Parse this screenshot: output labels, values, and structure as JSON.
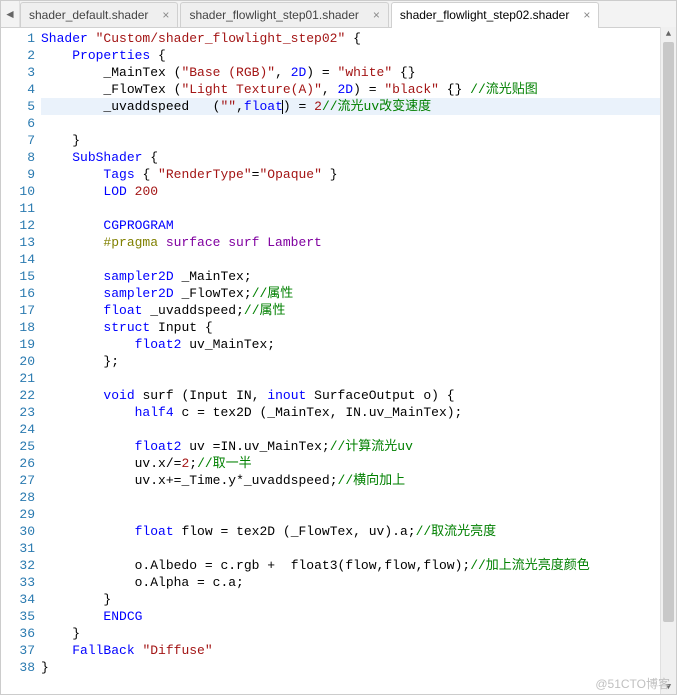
{
  "tabs": [
    {
      "label": "shader_default.shader",
      "active": false
    },
    {
      "label": "shader_flowlight_step01.shader",
      "active": false
    },
    {
      "label": "shader_flowlight_step02.shader",
      "active": true
    }
  ],
  "nav_prev": "◄",
  "nav_next": "",
  "close_glyph": "×",
  "scroll_up": "▲",
  "scroll_down": "▼",
  "watermark": "@51CTO博客",
  "current_line": 5,
  "code": [
    {
      "n": 1,
      "tokens": [
        [
          "kw",
          "Shader"
        ],
        [
          "op",
          " "
        ],
        [
          "str",
          "\"Custom/shader_flowlight_step02\""
        ],
        [
          "op",
          " {"
        ]
      ]
    },
    {
      "n": 2,
      "tokens": [
        [
          "op",
          "    "
        ],
        [
          "kw",
          "Properties"
        ],
        [
          "op",
          " {"
        ]
      ]
    },
    {
      "n": 3,
      "tokens": [
        [
          "op",
          "        "
        ],
        [
          "ident",
          "_MainTex"
        ],
        [
          "op",
          " ("
        ],
        [
          "str",
          "\"Base (RGB)\""
        ],
        [
          "op",
          ", "
        ],
        [
          "kw",
          "2D"
        ],
        [
          "op",
          ") = "
        ],
        [
          "str",
          "\"white\""
        ],
        [
          "op",
          " {}"
        ]
      ]
    },
    {
      "n": 4,
      "tokens": [
        [
          "op",
          "        "
        ],
        [
          "ident",
          "_FlowTex"
        ],
        [
          "op",
          " ("
        ],
        [
          "str",
          "\"Light Texture(A)\""
        ],
        [
          "op",
          ", "
        ],
        [
          "kw",
          "2D"
        ],
        [
          "op",
          ") = "
        ],
        [
          "str",
          "\"black\""
        ],
        [
          "op",
          " {} "
        ],
        [
          "comment",
          "//流光贴图"
        ]
      ]
    },
    {
      "n": 5,
      "tokens": [
        [
          "op",
          "        "
        ],
        [
          "ident",
          "_uvaddspeed"
        ],
        [
          "op",
          "   ("
        ],
        [
          "str",
          "\"\""
        ],
        [
          "op",
          ","
        ],
        [
          "kw",
          "float"
        ],
        [
          "caret",
          ""
        ],
        [
          "op",
          ") = "
        ],
        [
          "num",
          "2"
        ],
        [
          "comment",
          "//流光uv改变速度"
        ]
      ]
    },
    {
      "n": 6,
      "tokens": [
        [
          "op",
          ""
        ]
      ]
    },
    {
      "n": 7,
      "tokens": [
        [
          "op",
          "    }"
        ]
      ]
    },
    {
      "n": 8,
      "tokens": [
        [
          "op",
          "    "
        ],
        [
          "kw",
          "SubShader"
        ],
        [
          "op",
          " {"
        ]
      ]
    },
    {
      "n": 9,
      "tokens": [
        [
          "op",
          "        "
        ],
        [
          "kw",
          "Tags"
        ],
        [
          "op",
          " { "
        ],
        [
          "str",
          "\"RenderType\""
        ],
        [
          "op",
          "="
        ],
        [
          "str",
          "\"Opaque\""
        ],
        [
          "op",
          " }"
        ]
      ]
    },
    {
      "n": 10,
      "tokens": [
        [
          "op",
          "        "
        ],
        [
          "kw",
          "LOD"
        ],
        [
          "op",
          " "
        ],
        [
          "num",
          "200"
        ]
      ]
    },
    {
      "n": 11,
      "tokens": [
        [
          "op",
          ""
        ]
      ]
    },
    {
      "n": 12,
      "tokens": [
        [
          "op",
          "        "
        ],
        [
          "kw",
          "CGPROGRAM"
        ]
      ]
    },
    {
      "n": 13,
      "tokens": [
        [
          "op",
          "        "
        ],
        [
          "pragma",
          "#pragma"
        ],
        [
          "type",
          " surface surf Lambert"
        ]
      ]
    },
    {
      "n": 14,
      "tokens": [
        [
          "op",
          ""
        ]
      ]
    },
    {
      "n": 15,
      "tokens": [
        [
          "op",
          "        "
        ],
        [
          "kw",
          "sampler2D"
        ],
        [
          "op",
          " "
        ],
        [
          "ident",
          "_MainTex"
        ],
        [
          "op",
          ";"
        ]
      ]
    },
    {
      "n": 16,
      "tokens": [
        [
          "op",
          "        "
        ],
        [
          "kw",
          "sampler2D"
        ],
        [
          "op",
          " "
        ],
        [
          "ident",
          "_FlowTex"
        ],
        [
          "op",
          ";"
        ],
        [
          "comment",
          "//属性"
        ]
      ]
    },
    {
      "n": 17,
      "tokens": [
        [
          "op",
          "        "
        ],
        [
          "kw",
          "float"
        ],
        [
          "op",
          " "
        ],
        [
          "ident",
          "_uvaddspeed"
        ],
        [
          "op",
          ";"
        ],
        [
          "comment",
          "//属性"
        ]
      ]
    },
    {
      "n": 18,
      "tokens": [
        [
          "op",
          "        "
        ],
        [
          "kw",
          "struct"
        ],
        [
          "op",
          " "
        ],
        [
          "ident",
          "Input"
        ],
        [
          "op",
          " {"
        ]
      ]
    },
    {
      "n": 19,
      "tokens": [
        [
          "op",
          "            "
        ],
        [
          "kw",
          "float2"
        ],
        [
          "op",
          " "
        ],
        [
          "ident",
          "uv_MainTex"
        ],
        [
          "op",
          ";"
        ]
      ]
    },
    {
      "n": 20,
      "tokens": [
        [
          "op",
          "        };"
        ]
      ]
    },
    {
      "n": 21,
      "tokens": [
        [
          "op",
          ""
        ]
      ]
    },
    {
      "n": 22,
      "tokens": [
        [
          "op",
          "        "
        ],
        [
          "kw",
          "void"
        ],
        [
          "op",
          " "
        ],
        [
          "ident",
          "surf"
        ],
        [
          "op",
          " ("
        ],
        [
          "ident",
          "Input IN"
        ],
        [
          "op",
          ", "
        ],
        [
          "kw",
          "inout"
        ],
        [
          "op",
          " "
        ],
        [
          "ident",
          "SurfaceOutput o"
        ],
        [
          "op",
          ") {"
        ]
      ]
    },
    {
      "n": 23,
      "tokens": [
        [
          "op",
          "            "
        ],
        [
          "kw",
          "half4"
        ],
        [
          "op",
          " "
        ],
        [
          "ident",
          "c"
        ],
        [
          "op",
          " = "
        ],
        [
          "ident",
          "tex2D"
        ],
        [
          "op",
          " ("
        ],
        [
          "ident",
          "_MainTex"
        ],
        [
          "op",
          ", "
        ],
        [
          "ident",
          "IN.uv_MainTex"
        ],
        [
          "op",
          ");"
        ]
      ]
    },
    {
      "n": 24,
      "tokens": [
        [
          "op",
          ""
        ]
      ]
    },
    {
      "n": 25,
      "tokens": [
        [
          "op",
          "            "
        ],
        [
          "kw",
          "float2"
        ],
        [
          "op",
          " "
        ],
        [
          "ident",
          "uv"
        ],
        [
          "op",
          " ="
        ],
        [
          "ident",
          "IN.uv_MainTex"
        ],
        [
          "op",
          ";"
        ],
        [
          "comment",
          "//计算流光uv"
        ]
      ]
    },
    {
      "n": 26,
      "tokens": [
        [
          "op",
          "            "
        ],
        [
          "ident",
          "uv.x"
        ],
        [
          "op",
          "/="
        ],
        [
          "num",
          "2"
        ],
        [
          "op",
          ";"
        ],
        [
          "comment",
          "//取一半"
        ]
      ]
    },
    {
      "n": 27,
      "tokens": [
        [
          "op",
          "            "
        ],
        [
          "ident",
          "uv.x"
        ],
        [
          "op",
          "+="
        ],
        [
          "ident",
          "_Time.y"
        ],
        [
          "op",
          "*"
        ],
        [
          "ident",
          "_uvaddspeed"
        ],
        [
          "op",
          ";"
        ],
        [
          "comment",
          "//横向加上"
        ]
      ]
    },
    {
      "n": 28,
      "tokens": [
        [
          "op",
          ""
        ]
      ]
    },
    {
      "n": 29,
      "tokens": [
        [
          "op",
          ""
        ]
      ]
    },
    {
      "n": 30,
      "tokens": [
        [
          "op",
          "            "
        ],
        [
          "kw",
          "float"
        ],
        [
          "op",
          " "
        ],
        [
          "ident",
          "flow"
        ],
        [
          "op",
          " = "
        ],
        [
          "ident",
          "tex2D"
        ],
        [
          "op",
          " ("
        ],
        [
          "ident",
          "_FlowTex"
        ],
        [
          "op",
          ", "
        ],
        [
          "ident",
          "uv"
        ],
        [
          "op",
          ").a;"
        ],
        [
          "comment",
          "//取流光亮度"
        ]
      ]
    },
    {
      "n": 31,
      "tokens": [
        [
          "op",
          ""
        ]
      ]
    },
    {
      "n": 32,
      "tokens": [
        [
          "op",
          "            "
        ],
        [
          "ident",
          "o.Albedo"
        ],
        [
          "op",
          " = "
        ],
        [
          "ident",
          "c.rgb"
        ],
        [
          "op",
          " +  "
        ],
        [
          "ident",
          "float3"
        ],
        [
          "op",
          "("
        ],
        [
          "ident",
          "flow"
        ],
        [
          "op",
          ","
        ],
        [
          "ident",
          "flow"
        ],
        [
          "op",
          ","
        ],
        [
          "ident",
          "flow"
        ],
        [
          "op",
          ");"
        ],
        [
          "comment",
          "//加上流光亮度颜色"
        ]
      ]
    },
    {
      "n": 33,
      "tokens": [
        [
          "op",
          "            "
        ],
        [
          "ident",
          "o.Alpha"
        ],
        [
          "op",
          " = "
        ],
        [
          "ident",
          "c.a"
        ],
        [
          "op",
          ";"
        ]
      ]
    },
    {
      "n": 34,
      "tokens": [
        [
          "op",
          "        }"
        ]
      ]
    },
    {
      "n": 35,
      "tokens": [
        [
          "op",
          "        "
        ],
        [
          "kw",
          "ENDCG"
        ]
      ]
    },
    {
      "n": 36,
      "tokens": [
        [
          "op",
          "    }"
        ]
      ]
    },
    {
      "n": 37,
      "tokens": [
        [
          "op",
          "    "
        ],
        [
          "kw",
          "FallBack"
        ],
        [
          "op",
          " "
        ],
        [
          "str",
          "\"Diffuse\""
        ]
      ]
    },
    {
      "n": 38,
      "tokens": [
        [
          "op",
          "}"
        ]
      ]
    }
  ]
}
